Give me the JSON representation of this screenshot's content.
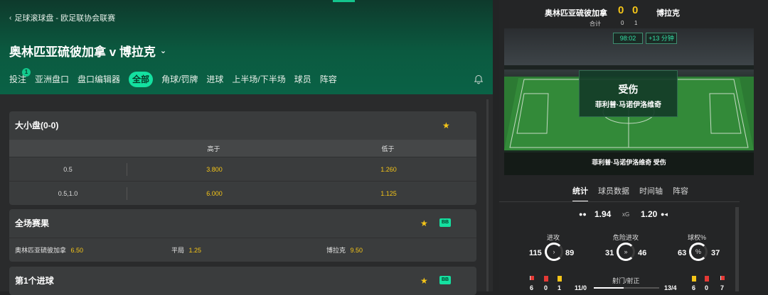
{
  "header": {
    "breadcrumb": "足球滚球盘 - 欧足联协会联赛",
    "match_title": "奥林匹亚硫彼加拿 v 博拉克",
    "tabs": [
      {
        "label": "投注",
        "badge": "1"
      },
      {
        "label": "亚洲盘口"
      },
      {
        "label": "盘口编辑器"
      },
      {
        "label": "全部",
        "active": true
      },
      {
        "label": "角球/罚牌"
      },
      {
        "label": "进球"
      },
      {
        "label": "上半场/下半场"
      },
      {
        "label": "球员"
      },
      {
        "label": "阵容"
      }
    ]
  },
  "over_under": {
    "title": "大小盘(0-0)",
    "col_over": "高于",
    "col_under": "低于",
    "rows": [
      {
        "line": "0.5",
        "over": "3.800",
        "under": "1.260"
      },
      {
        "line": "0.5,1.0",
        "over": "6.000",
        "under": "1.125"
      }
    ]
  },
  "full_time": {
    "title": "全场赛果",
    "bb_label": "BB",
    "home": "奥林匹亚硫彼加拿",
    "home_odds": "6.50",
    "draw": "平局",
    "draw_odds": "1.25",
    "away": "博拉克",
    "away_odds": "9.50"
  },
  "first_goal": {
    "title": "第1个进球",
    "bb_label": "BB"
  },
  "scoreboard": {
    "home": "奥林匹亚硫彼加拿",
    "away": "博拉克",
    "home_score": "0",
    "away_score": "0",
    "total_label": "合计",
    "home_total": "0",
    "away_total": "1",
    "clock": "98:02",
    "extra_time": "+13 分钟"
  },
  "event": {
    "title": "受伤",
    "player": "菲利普·马诺伊洛维奇",
    "ticker": "菲利普·马诺伊洛维奇 受伤"
  },
  "stats_tabs": [
    "统计",
    "球员数据",
    "时间轴",
    "阵容"
  ],
  "stats": {
    "xg_home": "1.94",
    "xg_label": "xG",
    "xg_away": "1.20",
    "attacks_label": "进攻",
    "attacks_home": "115",
    "attacks_away": "89",
    "danger_label": "危险进攻",
    "danger_home": "31",
    "danger_away": "46",
    "possession_label": "球权%",
    "possession_home": "63",
    "possession_away": "37",
    "shots_label": "射门/射正",
    "shots_home": "11/0",
    "shots_away": "13/4",
    "home_corners": "6",
    "home_reds": "0",
    "home_yellows": "1",
    "away_yellows": "6",
    "away_reds": "0",
    "away_corners": "7"
  },
  "colors": {
    "accent": "#14e0a0",
    "odds": "#f5c518",
    "header_green": "#0b5a40"
  }
}
